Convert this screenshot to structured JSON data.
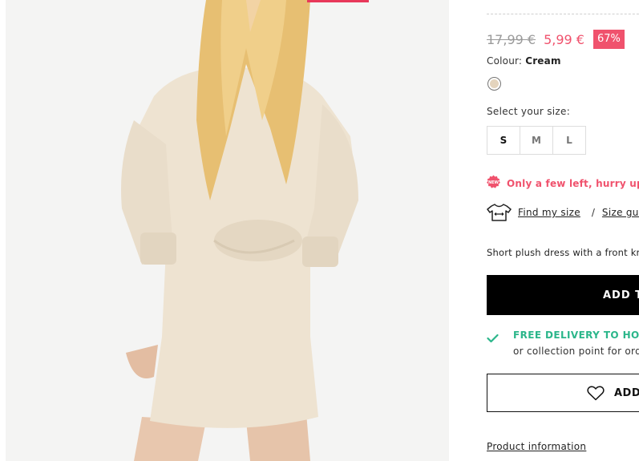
{
  "product": {
    "old_price": "17,99 €",
    "new_price": "5,99 €",
    "discount": "67%",
    "colour_label": "Colour:",
    "colour_value": "Cream",
    "swatch_color": "#e4d4bd",
    "size_label": "Select your size:",
    "sizes": [
      "S",
      "M",
      "L"
    ],
    "stock_warning": "Only a few left, hurry up!",
    "find_size": "Find my size",
    "separator": "/",
    "size_guide": "Size guid",
    "description": "Short plush dress with a front kno",
    "add_button": "ADD T",
    "delivery_title": "FREE DELIVERY TO HOME",
    "delivery_sub": "or collection point for ord",
    "wishlist_button": "ADD",
    "product_info": "Product information"
  },
  "colors": {
    "accent": "#f0526d",
    "delivery_green": "#2bb68a",
    "dress": "#eee3d1"
  },
  "icons": {
    "new_badge": "new-badge-icon",
    "tshirt": "tshirt-measure-icon",
    "check": "check-icon",
    "heart": "heart-icon"
  }
}
